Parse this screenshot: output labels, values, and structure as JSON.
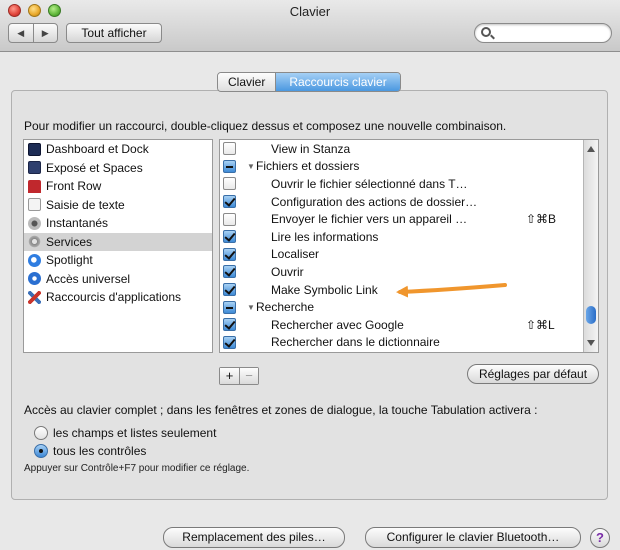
{
  "window": {
    "title": "Clavier"
  },
  "toolbar": {
    "back_glyph": "◀",
    "forward_glyph": "▶",
    "show_all_label": "Tout afficher",
    "search_placeholder": ""
  },
  "tabs": [
    {
      "label": "Clavier",
      "selected": false
    },
    {
      "label": "Raccourcis clavier",
      "selected": true
    }
  ],
  "instruction": "Pour modifier un raccourci, double-cliquez dessus et composez une nouvelle combinaison.",
  "categories": [
    {
      "label": "Dashboard et Dock",
      "icon": "dashboard-icon",
      "selected": false
    },
    {
      "label": "Exposé et Spaces",
      "icon": "expose-icon",
      "selected": false
    },
    {
      "label": "Front Row",
      "icon": "front-row-icon",
      "selected": false
    },
    {
      "label": "Saisie de texte",
      "icon": "text-input-icon",
      "selected": false
    },
    {
      "label": "Instantanés",
      "icon": "screenshot-icon",
      "selected": false
    },
    {
      "label": "Services",
      "icon": "services-gear-icon",
      "selected": true
    },
    {
      "label": "Spotlight",
      "icon": "spotlight-icon",
      "selected": false
    },
    {
      "label": "Accès universel",
      "icon": "universal-access-icon",
      "selected": false
    },
    {
      "label": "Raccourcis d'applications",
      "icon": "app-shortcuts-icon",
      "selected": false
    }
  ],
  "shortcuts": [
    {
      "label": "View in Stanza",
      "state": "unchecked",
      "group": false,
      "shortcut": ""
    },
    {
      "label": "Fichiers et dossiers",
      "state": "mixed",
      "group": true,
      "shortcut": ""
    },
    {
      "label": "Ouvrir le fichier sélectionné dans T…",
      "state": "unchecked",
      "group": false,
      "shortcut": ""
    },
    {
      "label": "Configuration des actions de dossier…",
      "state": "checked",
      "group": false,
      "shortcut": ""
    },
    {
      "label": "Envoyer le fichier vers un appareil …",
      "state": "unchecked",
      "group": false,
      "shortcut": "⇧⌘B"
    },
    {
      "label": "Lire les informations",
      "state": "checked",
      "group": false,
      "shortcut": ""
    },
    {
      "label": "Localiser",
      "state": "checked",
      "group": false,
      "shortcut": ""
    },
    {
      "label": "Ouvrir",
      "state": "checked",
      "group": false,
      "shortcut": ""
    },
    {
      "label": "Make Symbolic Link",
      "state": "checked",
      "group": false,
      "shortcut": ""
    },
    {
      "label": "Recherche",
      "state": "mixed",
      "group": true,
      "shortcut": ""
    },
    {
      "label": "Rechercher avec Google",
      "state": "checked",
      "group": false,
      "shortcut": "⇧⌘L"
    },
    {
      "label": "Rechercher dans le dictionnaire",
      "state": "checked",
      "group": false,
      "shortcut": ""
    }
  ],
  "list_buttons": {
    "add": "+",
    "remove": "−"
  },
  "defaults_button": "Réglages par défaut",
  "keyboard_access": {
    "text": "Accès au clavier complet ; dans les fenêtres et zones de dialogue, la touche Tabulation activera :",
    "options": [
      {
        "label": "les champs et listes seulement",
        "selected": false
      },
      {
        "label": "tous les contrôles",
        "selected": true
      }
    ],
    "hint": "Appuyer sur Contrôle+F7 pour modifier ce réglage."
  },
  "bottom": {
    "battery_button": "Remplacement des piles…",
    "bluetooth_button": "Configurer le clavier Bluetooth…",
    "help": "?"
  },
  "colors": {
    "accent": "#3e8ad6",
    "annotation_arrow": "#f0962d"
  }
}
